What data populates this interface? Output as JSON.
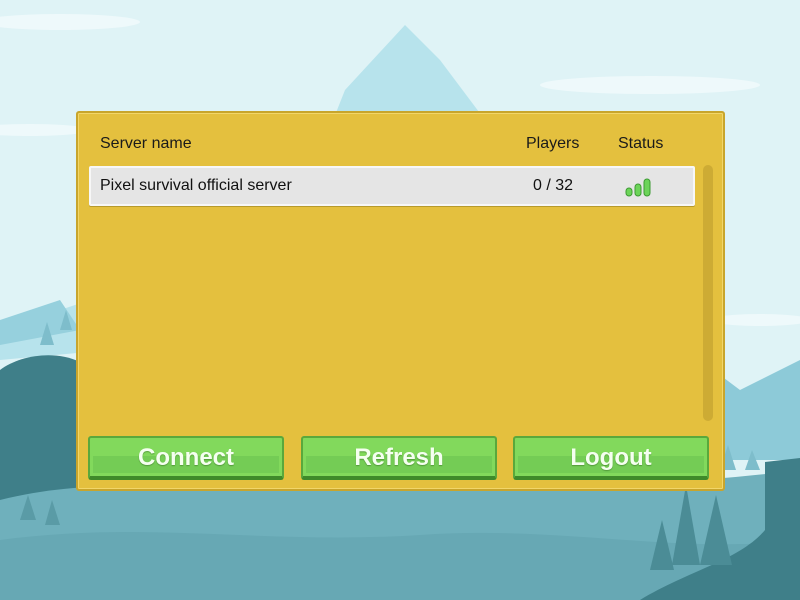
{
  "server_browser": {
    "columns": {
      "name": "Server name",
      "players": "Players",
      "status": "Status"
    },
    "servers": [
      {
        "name": "Pixel survival official server",
        "players": "0 / 32",
        "status_icon": "signal-strength-icon",
        "signal_bars": 3
      }
    ],
    "buttons": {
      "connect": "Connect",
      "refresh": "Refresh",
      "logout": "Logout"
    }
  },
  "colors": {
    "panel": "#e4c03e",
    "button": "#82d95c",
    "sky": "#dff3f6",
    "signal": "#5cc24a"
  }
}
